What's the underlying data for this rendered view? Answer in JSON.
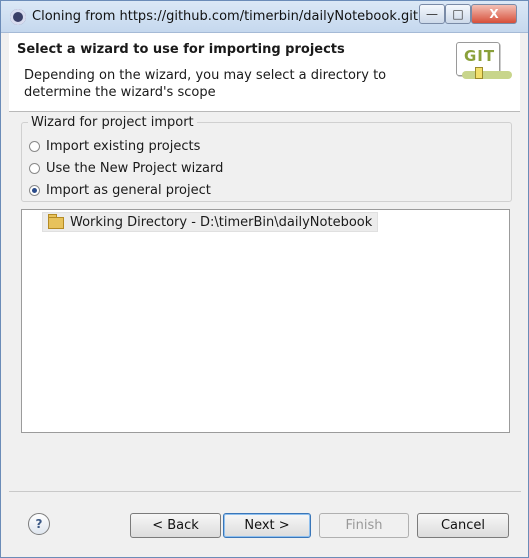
{
  "window": {
    "title": "Cloning from https://github.com/timerbin/dailyNotebook.git"
  },
  "controls": {
    "minimize": "—",
    "maximize": "□",
    "close": "X"
  },
  "header": {
    "title": "Select a wizard to use for importing projects",
    "description": "Depending on the wizard, you may select a directory to determine the wizard's scope",
    "logo_text": "GIT"
  },
  "group": {
    "legend": "Wizard for project import",
    "options": [
      {
        "label": "Import existing projects",
        "checked": false
      },
      {
        "label": "Use the New Project wizard",
        "checked": false
      },
      {
        "label": "Import as general project",
        "checked": true
      }
    ]
  },
  "tree": {
    "items": [
      {
        "label": "Working Directory - D:\\timerBin\\dailyNotebook"
      }
    ]
  },
  "buttons": {
    "help": "?",
    "back": "< Back",
    "next": "Next >",
    "finish": "Finish",
    "cancel": "Cancel"
  }
}
